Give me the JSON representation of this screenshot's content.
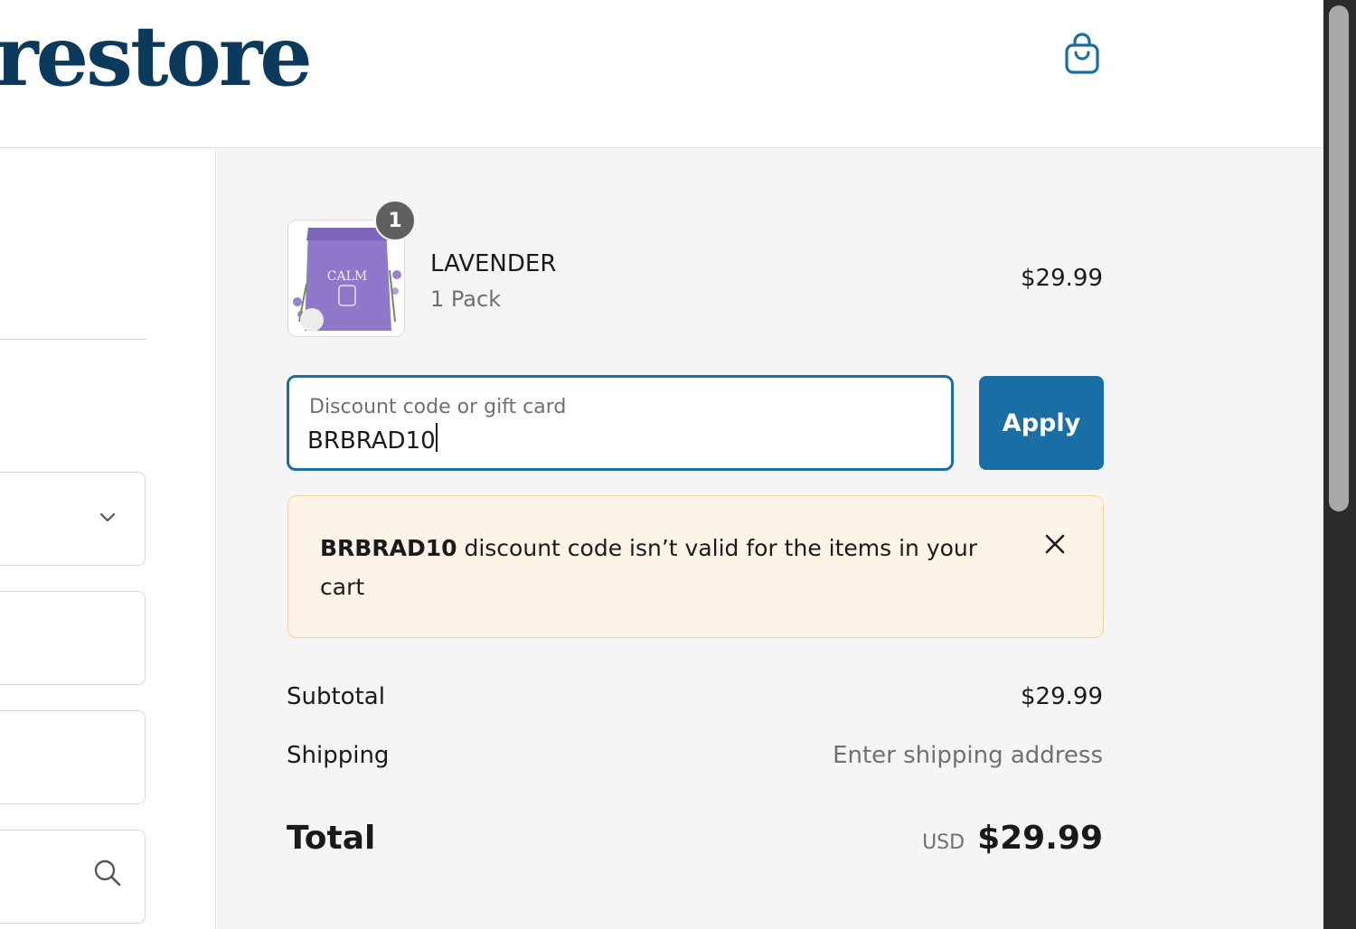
{
  "header": {
    "brand": "ody restore",
    "cart_icon": "shopping-bag-icon"
  },
  "colors": {
    "brand": "#0b3a5d",
    "accent": "#1a6ea6",
    "warning_bg": "#fdf3e7",
    "warning_border": "#f1d2a5"
  },
  "order": {
    "item": {
      "quantity": "1",
      "name": "LAVENDER",
      "variant": "1 Pack",
      "price": "$29.99",
      "image_label": "CALM"
    },
    "discount": {
      "label": "Discount code or gift card",
      "value": "BRBRAD10",
      "apply_label": "Apply"
    },
    "alert": {
      "code": "BRBRAD10",
      "message": " discount code isn’t valid for the items in your cart"
    },
    "subtotal_label": "Subtotal",
    "subtotal_value": "$29.99",
    "shipping_label": "Shipping",
    "shipping_value": "Enter shipping address",
    "total_label": "Total",
    "currency": "USD",
    "total_value": "$29.99"
  }
}
